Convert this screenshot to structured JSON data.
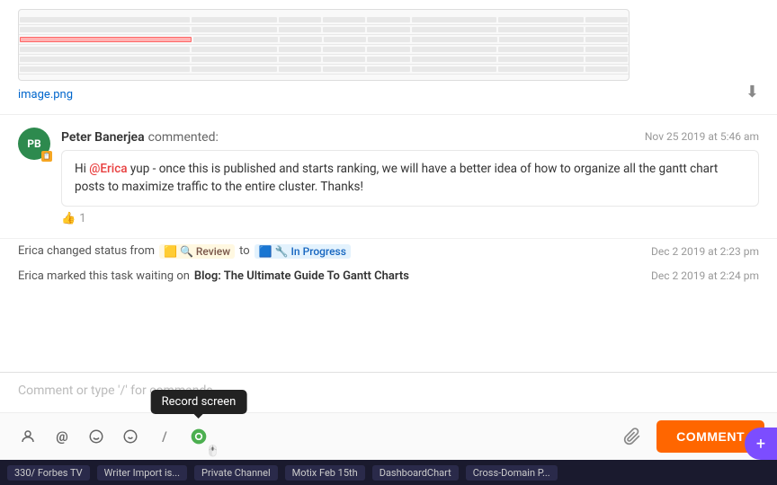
{
  "image": {
    "filename": "image.png",
    "download_icon": "⬇"
  },
  "comment": {
    "avatar_initials": "PB",
    "avatar_badge": "📋",
    "commenter": "Peter Banerjea",
    "commented_label": "commented:",
    "timestamp": "Nov 25 2019 at 5:46 am",
    "mention": "@Erica",
    "body_text": " yup - once this is published and starts ranking, we will have a better idea of how to organize all the gantt chart posts to maximize traffic to the entire cluster. Thanks!",
    "like_count": "1"
  },
  "activity": {
    "items": [
      {
        "text_before": "Erica changed status from",
        "from_status": "🟨 🔍 Review",
        "to_label": "to",
        "to_status": "🟦 🔧 In Progress",
        "timestamp": "Dec 2 2019 at 2:23 pm"
      },
      {
        "text_before": "Erica marked this task waiting on",
        "task_link": "Blog: The Ultimate Guide To Gantt Charts",
        "timestamp": "Dec 2 2019 at 2:24 pm"
      }
    ]
  },
  "comment_input": {
    "placeholder": "Comment or type '/' for commands"
  },
  "toolbar": {
    "icons": [
      {
        "name": "mention-person-icon",
        "symbol": "👤"
      },
      {
        "name": "at-mention-icon",
        "symbol": "@"
      },
      {
        "name": "emoji-icon",
        "symbol": "🙂"
      },
      {
        "name": "smiley-icon",
        "symbol": "😊"
      },
      {
        "name": "slash-commands-icon",
        "symbol": "/"
      },
      {
        "name": "record-screen-icon",
        "symbol": "⏺",
        "active": true
      }
    ],
    "tooltip_text": "Record screen",
    "attach_icon": "📎",
    "comment_button": "COMMENT"
  },
  "taskbar": {
    "items": [
      "330/ Forbes TV",
      "Writer Import is...",
      "Private Channel",
      "Motix Feb 15th",
      "DashboardChart",
      "Cross-Domain P..."
    ]
  },
  "fab": {
    "symbol": "+"
  }
}
